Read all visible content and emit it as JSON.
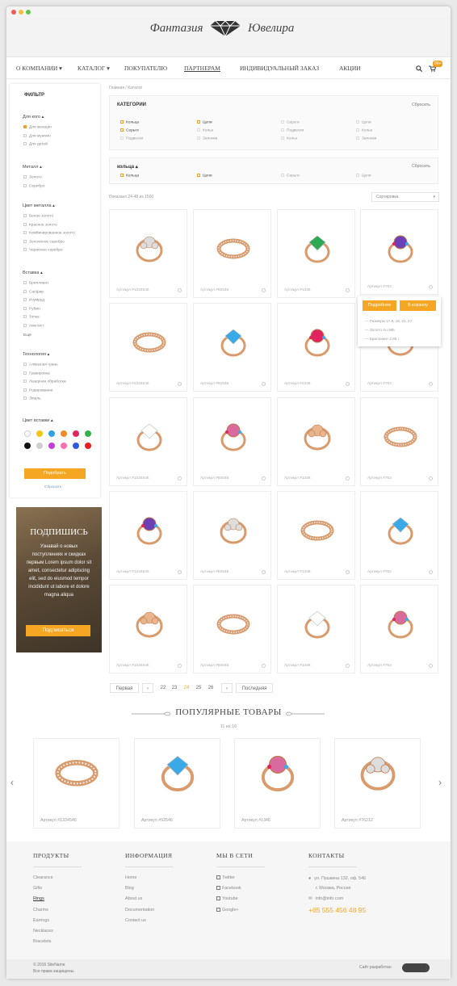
{
  "logo": {
    "left": "Фантазия",
    "right": "Ювелира"
  },
  "nav": {
    "items": [
      "О КОМПАНИИ",
      "КАТАЛОГ",
      "ПОКУПАТЕЛЮ",
      "ПАРТНЕРАМ",
      "ИНДИВИДУАЛЬНЫЙ ЗАКАЗ",
      "АКЦИИ"
    ],
    "cart_badge": "99+"
  },
  "sidebar": {
    "title": "ФИЛЬТР",
    "groups": [
      {
        "title": "Для кого",
        "items": [
          "Для женщин",
          "Для мужчин",
          "Для детей"
        ]
      },
      {
        "title": "Металл",
        "items": [
          "Золото",
          "Серебро"
        ]
      },
      {
        "title": "Цвет металла",
        "items": [
          "Белое золото",
          "Красное золото",
          "Комбинированное золото",
          "Золочёное серебро",
          "Чернёное серебро"
        ]
      },
      {
        "title": "Вставка",
        "items": [
          "Бриллиант",
          "Сапфир",
          "Изумруд",
          "Рубин",
          "Топаз",
          "Аметист"
        ]
      },
      {
        "title": "Технология",
        "items": [
          "Алмазная грань",
          "Гравировка",
          "Лазерная обработка",
          "Родирование",
          "Эмаль"
        ]
      }
    ],
    "more": "Ещё",
    "color_title": "Цвет вставки",
    "apply": "Подобрать",
    "reset": "Сбросить"
  },
  "subscribe": {
    "title": "ПОДПИШИСЬ",
    "text": "Узнавай о новых поступлениях и скидках первым Lorem ipsum dolor sit amet, consectetur adipiscing elit, sed do eiusmod tempor incididunt ut labore et dolore magna aliqua",
    "button": "Подписаться"
  },
  "breadcrumb": "Главная / Каталог",
  "categories": {
    "title": "КАТЕГОРИИ",
    "reset": "Сбросить",
    "items": [
      {
        "label": "Кольца",
        "checked": true
      },
      {
        "label": "Цепи",
        "checked": true
      },
      {
        "label": "Серьги",
        "checked": false
      },
      {
        "label": "Цепи",
        "checked": false
      },
      {
        "label": "Серьги",
        "checked": true
      },
      {
        "label": "Колье",
        "checked": false
      },
      {
        "label": "Подвески",
        "checked": false
      },
      {
        "label": "Колье",
        "checked": false
      },
      {
        "label": "Подвески",
        "checked": false
      },
      {
        "label": "Запонки",
        "checked": false
      },
      {
        "label": "Колье",
        "checked": false
      },
      {
        "label": "Запонки",
        "checked": false
      }
    ]
  },
  "rings_filter": {
    "title": "кольца",
    "reset": "Сбросить",
    "items": [
      {
        "label": "Кольца",
        "checked": true
      },
      {
        "label": "Цепи",
        "checked": true
      },
      {
        "label": "Серьги",
        "checked": false
      },
      {
        "label": "Цепи",
        "checked": false
      }
    ]
  },
  "showing": "Показано 24-48 из 1500",
  "sort": "Сортировка",
  "products": [
    "Артикул #1334546",
    "Артикул #92546",
    "Артикул #1346",
    "Артикул #762",
    "Артикул #1334546",
    "Артикул #92546",
    "Артикул #1346",
    "Артикул #762",
    "Артикул #1334546",
    "Артикул #92546",
    "Артикул #1346",
    "Артикул #762",
    "Артикул #1334546",
    "Артикул #92546",
    "Артикул #1346",
    "Артикул #762",
    "Артикул #1334546",
    "Артикул #92546",
    "Артикул #1346",
    "Артикул #762"
  ],
  "popup": {
    "details": "Подробнее",
    "cart": "В корзину",
    "lines": [
      "— Размеры 17.5, 19, 22, 27",
      "— Золото Au 585",
      "— Бриллиант 2,85 г"
    ]
  },
  "pager": {
    "first": "Первая",
    "pages": [
      "22",
      "23",
      "24",
      "25",
      "26"
    ],
    "last": "Последняя",
    "current": "24"
  },
  "popular": {
    "title": "ПОПУЛЯРНЫЕ ТОВАРЫ",
    "count": "11 из 16",
    "items": [
      "Артикул #1334546",
      "Артикул #92546",
      "Артикул #1346",
      "Артикул #76212"
    ]
  },
  "footer": {
    "products": {
      "title": "ПРОДУКТЫ",
      "links": [
        "Clearance",
        "Gifts",
        "Rings",
        "Charms",
        "Earrings",
        "Necklaces",
        "Bracelets"
      ]
    },
    "info": {
      "title": "ИНФОРМАЦИЯ",
      "links": [
        "Home",
        "Blog",
        "About us",
        "Documentation",
        "Contact us"
      ]
    },
    "social": {
      "title": "МЫ В СЕТИ",
      "links": [
        "Twitter",
        "Facebook",
        "Youtube",
        "Google+"
      ]
    },
    "contacts": {
      "title": "КОНТАКТЫ",
      "address1": "ул. Пушкина 132, оф. 546",
      "address2": "г. Москва, Россия",
      "email": "info@info.com",
      "phone": "+65  555 456 48 95"
    },
    "copyright1": "© 2016 SiteName",
    "copyright2": "Все права защищены.",
    "dev": "Сайт разработан"
  },
  "colors": {
    "accent": "#f5a623",
    "swatches": [
      "#ffffff",
      "#f5c518",
      "#2ea3e0",
      "#f08a2a",
      "#e0245e",
      "#33b24a",
      "#111111",
      "#cfcfcf",
      "#c13fd6",
      "#ff6fae",
      "#2f5bd8",
      "#e52020"
    ]
  }
}
